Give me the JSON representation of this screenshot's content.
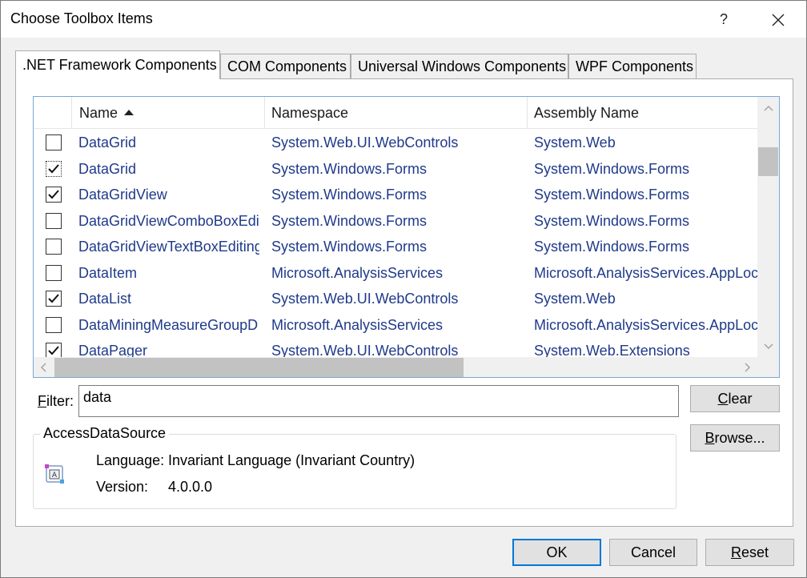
{
  "window": {
    "title": "Choose Toolbox Items",
    "help_label": "?"
  },
  "tabs": [
    {
      "label": ".NET Framework Components",
      "active": true
    },
    {
      "label": "COM Components",
      "active": false
    },
    {
      "label": "Universal Windows Components",
      "active": false
    },
    {
      "label": "WPF Components",
      "active": false
    }
  ],
  "list": {
    "columns": {
      "name": "Name",
      "namespace": "Namespace",
      "assembly": "Assembly Name"
    },
    "sort": {
      "column": "Name",
      "direction": "ascending"
    },
    "rows": [
      {
        "checked": false,
        "focused": false,
        "name": "DataGrid",
        "namespace": "System.Web.UI.WebControls",
        "assembly": "System.Web"
      },
      {
        "checked": true,
        "focused": true,
        "name": "DataGrid",
        "namespace": "System.Windows.Forms",
        "assembly": "System.Windows.Forms"
      },
      {
        "checked": true,
        "focused": false,
        "name": "DataGridView",
        "namespace": "System.Windows.Forms",
        "assembly": "System.Windows.Forms"
      },
      {
        "checked": false,
        "focused": false,
        "name": "DataGridViewComboBoxEdit",
        "namespace": "System.Windows.Forms",
        "assembly": "System.Windows.Forms"
      },
      {
        "checked": false,
        "focused": false,
        "name": "DataGridViewTextBoxEditing",
        "namespace": "System.Windows.Forms",
        "assembly": "System.Windows.Forms"
      },
      {
        "checked": false,
        "focused": false,
        "name": "DataItem",
        "namespace": "Microsoft.AnalysisServices",
        "assembly": "Microsoft.AnalysisServices.AppLoca"
      },
      {
        "checked": true,
        "focused": false,
        "name": "DataList",
        "namespace": "System.Web.UI.WebControls",
        "assembly": "System.Web"
      },
      {
        "checked": false,
        "focused": false,
        "name": "DataMiningMeasureGroupD",
        "namespace": "Microsoft.AnalysisServices",
        "assembly": "Microsoft.AnalysisServices.AppLoca"
      },
      {
        "checked": true,
        "focused": false,
        "name": "DataPager",
        "namespace": "System.Web.UI.WebControls",
        "assembly": "System.Web.Extensions"
      }
    ]
  },
  "filter": {
    "label_access_key": "F",
    "label_rest": "ilter:",
    "value": "data"
  },
  "buttons": {
    "clear": {
      "access_key": "C",
      "rest": "lear"
    },
    "browse": {
      "access_key": "B",
      "rest": "rowse..."
    },
    "ok": "OK",
    "cancel": "Cancel",
    "reset": {
      "access_key": "R",
      "rest": "eset"
    }
  },
  "details": {
    "component": "AccessDataSource",
    "language_label": "Language:",
    "language_value": "Invariant Language (Invariant Country)",
    "version_label": "Version:",
    "version_value": "4.0.0.0"
  },
  "colors": {
    "link_text": "#1f3a8a",
    "focus_border": "#0078d7",
    "list_border": "#7aa7d6"
  }
}
